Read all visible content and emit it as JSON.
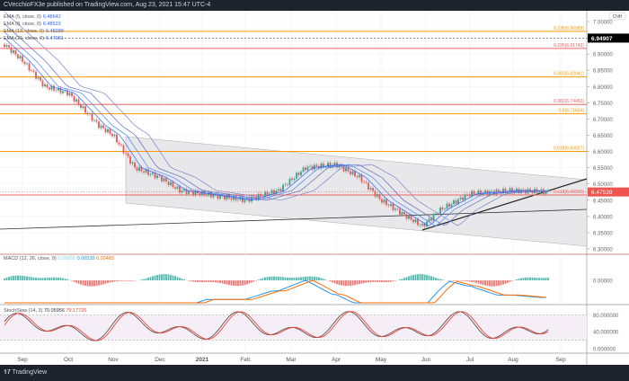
{
  "header": {
    "publisher": "CVecchioFX3e published on TradingView.com, Aug 23, 2021 15:47 UTC-4"
  },
  "footer": {
    "brand": "TradingView"
  },
  "symbol_badge": "CNH",
  "legends": {
    "ema": [
      {
        "label": "EMA (5, close, 0)",
        "value": "6.48642"
      },
      {
        "label": "EMA (8, close, 0)",
        "value": "6.48522"
      },
      {
        "label": "EMA (13, close, 0)",
        "value": "6.48289"
      },
      {
        "label": "EMA (21, close, 0)",
        "value": "6.47981"
      }
    ],
    "macd": {
      "label": "MACD (12, 26, close, 9)",
      "values": [
        "0.00055",
        "0.00538",
        "0.00483"
      ]
    },
    "stoch": {
      "label": "StochSlow (14, 3)",
      "values": [
        "70.05956",
        "79.17726"
      ]
    }
  },
  "colors": {
    "up": "#26a69a",
    "down": "#ef5350",
    "fib_orange": "#ff9800",
    "fib_red": "#f06262",
    "macd": "#2196f3",
    "signal": "#ff6d00",
    "stoch_k": "#555555",
    "stoch_d": "#f44336"
  },
  "chart_data": {
    "type": "line",
    "title": "",
    "price_axis": [
      "7.00000",
      "6.95000",
      "6.90000",
      "6.85000",
      "6.80000",
      "6.75000",
      "6.70000",
      "6.65000",
      "6.60000",
      "6.55000",
      "6.50000",
      "6.45000",
      "6.40000",
      "6.35000",
      "6.30000"
    ],
    "ylim": [
      6.28,
      7.03
    ],
    "time_axis": [
      "Sep",
      "Oct",
      "Nov",
      "Dec",
      "2021",
      "Feb",
      "Mar",
      "Apr",
      "May",
      "Jun",
      "Jul",
      "Aug",
      "Sep"
    ],
    "last_price": "6.47539",
    "marked_price": "6.94907",
    "fib_levels": [
      {
        "label": "0.236(6.96989)",
        "price": 6.9699,
        "color": "orange"
      },
      {
        "label": "0.236(6.91743)",
        "price": 6.9174,
        "color": "red"
      },
      {
        "label": "0.382(6.82941)",
        "price": 6.8294,
        "color": "orange"
      },
      {
        "label": "0.382(6.74482)",
        "price": 6.7448,
        "color": "red"
      },
      {
        "label": "0.5(6.71604)",
        "price": 6.716,
        "color": "orange"
      },
      {
        "label": "0.618(6.60027)",
        "price": 6.6003,
        "color": "orange"
      },
      {
        "label": "0.618(6.46590)",
        "price": 6.4659,
        "color": "red"
      }
    ],
    "series": [
      {
        "x": [
          "2020-08-25",
          "2020-09-01",
          "2020-09-15",
          "2020-10-01",
          "2020-10-20",
          "2020-11-01",
          "2020-11-15",
          "2020-12-01",
          "2020-12-15",
          "2021-01-01",
          "2021-02-01",
          "2021-02-25",
          "2021-03-15",
          "2021-04-01",
          "2021-04-15",
          "2021-05-01",
          "2021-05-28",
          "2021-06-10",
          "2021-07-01",
          "2021-08-01",
          "2021-08-23"
        ],
        "values": [
          6.93,
          6.88,
          6.8,
          6.78,
          6.68,
          6.65,
          6.55,
          6.52,
          6.48,
          6.47,
          6.45,
          6.48,
          6.55,
          6.56,
          6.52,
          6.45,
          6.37,
          6.42,
          6.47,
          6.48,
          6.475
        ]
      }
    ],
    "macd_axis": [
      "0.00000"
    ],
    "stoch_axis": [
      "80.000000",
      "40.000000",
      "0.000000"
    ]
  }
}
